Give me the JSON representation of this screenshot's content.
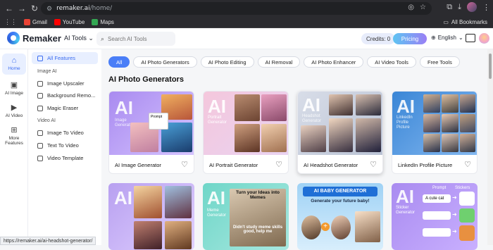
{
  "browser": {
    "url_host": "remaker.ai",
    "url_path": "/home/",
    "bookmarks": [
      {
        "label": "Gmail",
        "color": "#ea4335"
      },
      {
        "label": "YouTube",
        "color": "#ff0000"
      },
      {
        "label": "Maps",
        "color": "#34a853"
      }
    ],
    "all_bookmarks": "All Bookmarks"
  },
  "header": {
    "logo": "Remaker",
    "ai_tools": "AI Tools",
    "search_placeholder": "Search AI Tools",
    "credits": "Credits: 0",
    "pricing": "Pricing",
    "language": "English"
  },
  "rail": [
    {
      "label": "Home",
      "icon": "home-icon"
    },
    {
      "label": "AI Image",
      "icon": "image-icon"
    },
    {
      "label": "AI Video",
      "icon": "video-icon"
    },
    {
      "label": "More Features",
      "icon": "grid-icon"
    }
  ],
  "sub_sidebar": {
    "all_features": "All Features",
    "image_ai_head": "Image AI",
    "image_items": [
      "Image Upscaler",
      "Background Remo...",
      "Magic Eraser"
    ],
    "video_ai_head": "Video AI",
    "video_items": [
      "Image To Video",
      "Text To Video",
      "Video Template"
    ]
  },
  "chips": [
    "All",
    "AI Photo Generators",
    "AI Photo Editing",
    "AI Removal",
    "AI Photo Enhancer",
    "AI Video Tools",
    "Free Tools"
  ],
  "section_title": "AI Photo Generators",
  "cards_row1": [
    {
      "label": "AI Image Generator",
      "ai": "AI",
      "sub": "Image Generator"
    },
    {
      "label": "AI Portrait Generator",
      "ai": "AI",
      "sub": "Portrait Generator"
    },
    {
      "label": "AI Headshot Generator",
      "ai": "AI",
      "sub": "Headshot Generator"
    },
    {
      "label": "LinkedIn Profile Picture",
      "ai": "AI",
      "sub": "LinkedIn Profile Picture"
    }
  ],
  "card1_prompt": "Prompt",
  "cards_row2": {
    "meme_ai": "AI",
    "meme_sub": "Meme Generator",
    "meme_top": "Turn your Ideas into Memes",
    "meme_bottom": "Didn't study meme skills good, help me",
    "baby_title": "AI BABY GENERATOR",
    "baby_sub": "Generate your future baby!",
    "sticker_ai": "AI",
    "sticker_sub": "Sticker Generator",
    "sticker_prompt": "Prompt",
    "sticker_stickers": "Stickers",
    "sticker_cute": "A cute cat"
  },
  "status_url": "https://remaker.ai/ai-headshot-generator/"
}
